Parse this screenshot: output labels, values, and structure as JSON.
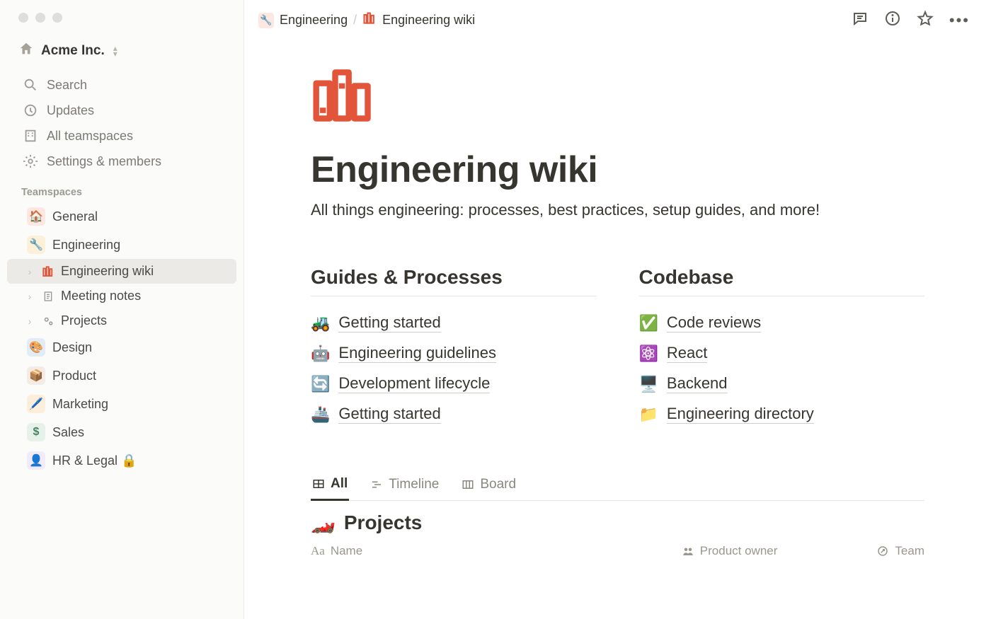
{
  "workspace": {
    "name": "Acme Inc."
  },
  "nav": {
    "search": "Search",
    "updates": "Updates",
    "all_teamspaces": "All teamspaces",
    "settings": "Settings & members"
  },
  "teamspaces_label": "Teamspaces",
  "teamspaces": [
    {
      "emoji": "🏠",
      "label": "General",
      "badge": "red"
    },
    {
      "emoji": "🔧",
      "label": "Engineering",
      "badge": "yellow"
    },
    {
      "emoji": "🎨",
      "label": "Design",
      "badge": "blue"
    },
    {
      "emoji": "📦",
      "label": "Product",
      "badge": "brown"
    },
    {
      "emoji": "🖊️",
      "label": "Marketing",
      "badge": "orange"
    },
    {
      "emoji": "$",
      "label": "Sales",
      "badge": "green"
    },
    {
      "emoji": "👤",
      "label": "HR & Legal 🔒",
      "badge": "purple"
    }
  ],
  "engineering_pages": [
    {
      "icon": "books",
      "label": "Engineering wiki",
      "active": true
    },
    {
      "icon": "📄",
      "label": "Meeting notes"
    },
    {
      "icon": "⚙️",
      "label": "Projects"
    }
  ],
  "breadcrumb": {
    "root": "Engineering",
    "page": "Engineering wiki"
  },
  "page": {
    "title": "Engineering wiki",
    "subtitle": "All things engineering: processes, best practices, setup guides, and more!"
  },
  "columns": {
    "left": {
      "heading": "Guides & Processes",
      "items": [
        {
          "emoji": "🚜",
          "label": "Getting started"
        },
        {
          "emoji": "🤖",
          "label": "Engineering guidelines"
        },
        {
          "emoji": "🔄",
          "label": "Development lifecycle"
        },
        {
          "emoji": "🚢",
          "label": "Getting started"
        }
      ]
    },
    "right": {
      "heading": "Codebase",
      "items": [
        {
          "emoji": "✅",
          "label": "Code reviews"
        },
        {
          "emoji": "⚛️",
          "label": "React"
        },
        {
          "emoji": "🖥️",
          "label": "Backend"
        },
        {
          "emoji": "📁",
          "label": "Engineering directory"
        }
      ]
    }
  },
  "db": {
    "tabs": [
      {
        "label": "All",
        "active": true
      },
      {
        "label": "Timeline"
      },
      {
        "label": "Board"
      }
    ],
    "title_emoji": "🏎️",
    "title": "Projects",
    "columns": [
      {
        "label": "Name",
        "icon": "Aa"
      },
      {
        "label": "Product owner",
        "icon": "people"
      },
      {
        "label": "Team",
        "icon": "arrow"
      }
    ]
  }
}
